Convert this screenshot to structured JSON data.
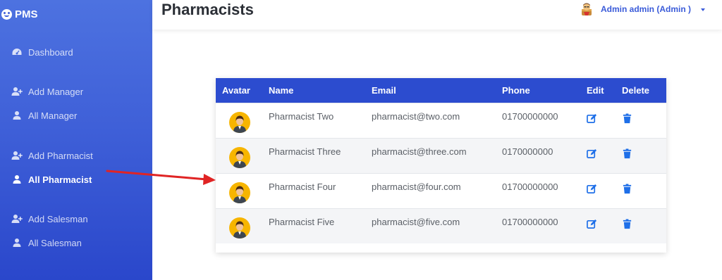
{
  "brand": {
    "name": "PMS"
  },
  "sidebar": {
    "items": [
      {
        "label": "Dashboard",
        "icon": "dashboard-icon"
      },
      {
        "label": "Add Manager",
        "icon": "user-plus-icon"
      },
      {
        "label": "All Manager",
        "icon": "user-icon"
      },
      {
        "label": "Add Pharmacist",
        "icon": "user-plus-icon"
      },
      {
        "label": "All Pharmacist",
        "icon": "user-icon",
        "active": true
      },
      {
        "label": "Add Salesman",
        "icon": "user-plus-icon"
      },
      {
        "label": "All Salesman",
        "icon": "user-icon"
      }
    ]
  },
  "header": {
    "title": "Pharmacists",
    "user": "Admin admin (Admin )"
  },
  "table": {
    "columns": [
      "Avatar",
      "Name",
      "Email",
      "Phone",
      "Edit",
      "Delete"
    ],
    "rows": [
      {
        "name": "Pharmacist Two",
        "email": "pharmacist@two.com",
        "phone": "01700000000"
      },
      {
        "name": "Pharmacist Three",
        "email": "pharmacist@three.com",
        "phone": "0170000000"
      },
      {
        "name": "Pharmacist Four",
        "email": "pharmacist@four.com",
        "phone": "01700000000"
      },
      {
        "name": "Pharmacist Five",
        "email": "pharmacist@five.com",
        "phone": "01700000000"
      }
    ]
  },
  "colors": {
    "sidebar_top": "#4d72e0",
    "sidebar_bottom": "#2a47cb",
    "table_header": "#2c4ccf",
    "accent": "#3a5bd9",
    "action_blue": "#1e6fe8",
    "annotation_arrow": "#e02424"
  }
}
